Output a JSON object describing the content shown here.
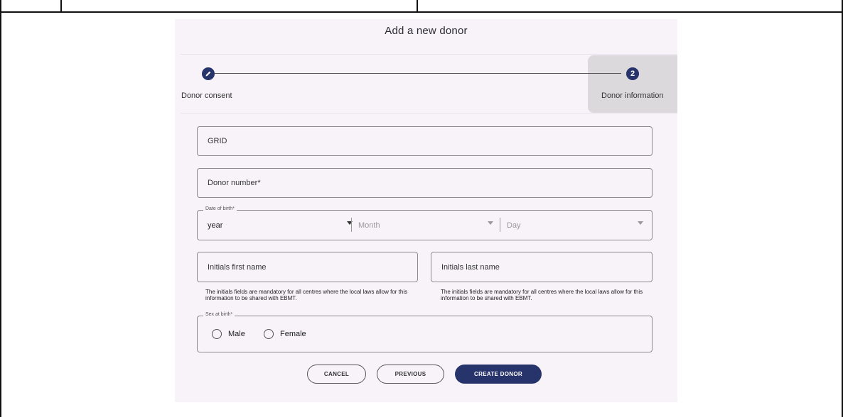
{
  "dialog": {
    "title": "Add a new donor"
  },
  "stepper": {
    "steps": [
      {
        "label": "Donor consent",
        "icon": "pencil-icon",
        "state": "completed"
      },
      {
        "label": "Donor information",
        "number": "2",
        "state": "active"
      }
    ],
    "accent_color": "#27336b"
  },
  "form": {
    "grid": {
      "placeholder": "GRID",
      "value": ""
    },
    "donor_number": {
      "placeholder": "Donor number*",
      "value": ""
    },
    "date_of_birth": {
      "legend": "Date of birth*",
      "year": "year",
      "month": "Month",
      "day": "Day"
    },
    "initials_first": {
      "placeholder": "Initials first name",
      "value": "",
      "helper": "The initials fields are mandatory for all centres where the local laws allow for this information to be shared with EBMT."
    },
    "initials_last": {
      "placeholder": "Initials last name",
      "value": "",
      "helper": "The initials fields are mandatory for all centres where the local laws allow for this information to be shared with EBMT."
    },
    "sex_at_birth": {
      "legend": "Sex at birth*",
      "options": [
        "Male",
        "Female"
      ]
    }
  },
  "actions": {
    "cancel": "CANCEL",
    "previous": "PREVIOUS",
    "create": "CREATE DONOR"
  }
}
